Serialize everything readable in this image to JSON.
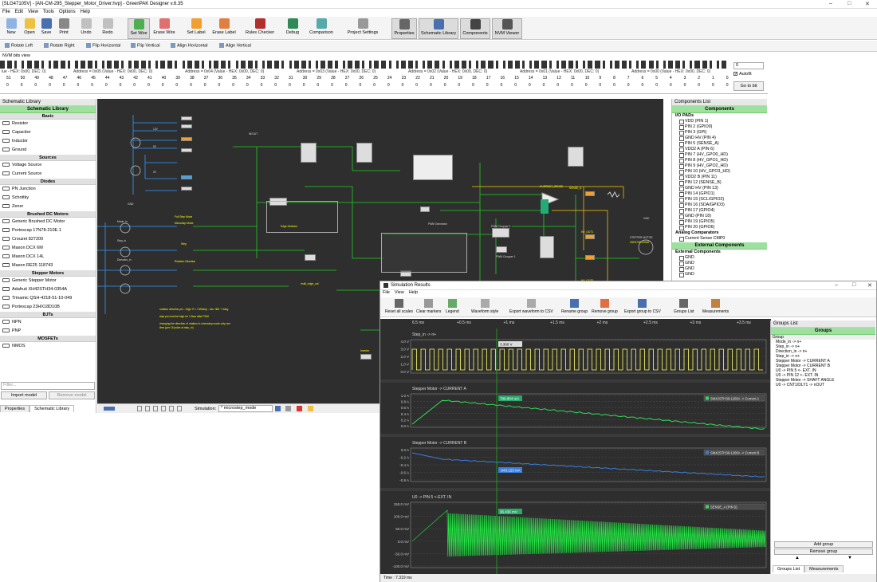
{
  "window": {
    "title": "[SLG47105V] - [AN-CM-295_Stepper_Motor_Driver.hvp] - GreenPAK Designer v.6.35",
    "min": "–",
    "max": "□",
    "close": "✕"
  },
  "menu": [
    "File",
    "Edit",
    "View",
    "Tools",
    "Options",
    "Help"
  ],
  "toolbar": [
    {
      "label": "New",
      "color": "#8fb4e3"
    },
    {
      "label": "Open",
      "color": "#f0c040"
    },
    {
      "label": "Save",
      "color": "#4a6fb0"
    },
    {
      "label": "Print",
      "color": "#888888"
    },
    {
      "label": "Undo",
      "color": "#c0c0c0"
    },
    {
      "label": "Redo",
      "color": "#c0c0c0"
    },
    {
      "label": "Set Wire",
      "color": "#4caf50",
      "on": true
    },
    {
      "label": "Erase Wire",
      "color": "#e07070"
    },
    {
      "label": "Set Label",
      "color": "#f0a030"
    },
    {
      "label": "Erase Label",
      "color": "#e08040"
    },
    {
      "label": "Rules Checker",
      "color": "#b03030"
    },
    {
      "label": "Debug",
      "color": "#2e8b57"
    },
    {
      "label": "Comparison",
      "color": "#5aa"
    },
    {
      "label": "Project Settings",
      "color": "#999999"
    },
    {
      "label": "Properties",
      "color": "#666666",
      "on": true
    },
    {
      "label": "Schematic Library",
      "color": "#4a6fb0",
      "on": true
    },
    {
      "label": "Components",
      "color": "#444444",
      "on": true
    },
    {
      "label": "NVM Viewer",
      "color": "#555555",
      "on": true
    }
  ],
  "toolbar2": [
    "Rotate Left",
    "Rotate Right",
    "Flip Horizontal",
    "Flip Vertical",
    "Align Horizontal",
    "Align Vertical"
  ],
  "nvm": {
    "title": "NVM bits view",
    "addresses": [
      "Address = 0x05 (Value - HEX: 0x00, DEC: 0)",
      "Address = 0x04 (Value - HEX: 0x00, DEC: 0)",
      "Address = 0x03 (Value - HEX: 0x00, DEC: 0)",
      "Address = 0x02 (Value - HEX: 0x00, DEC: 0)",
      "Address = 0x01 (Value - HEX: 0x00, DEC: 0)",
      "Address = 0x00 (Value - HEX: 0x00, DEC: 0)"
    ],
    "first_addr": "lue - HEX: 0x00, DEC: 0)",
    "bits": [
      "51",
      "50",
      "49",
      "48",
      "47",
      "46",
      "45",
      "44",
      "43",
      "42",
      "41",
      "40",
      "39",
      "38",
      "37",
      "36",
      "35",
      "34",
      "33",
      "32",
      "31",
      "30",
      "29",
      "28",
      "27",
      "26",
      "25",
      "24",
      "23",
      "22",
      "21",
      "20",
      "19",
      "18",
      "17",
      "16",
      "15",
      "14",
      "13",
      "12",
      "11",
      "10",
      "9",
      "8",
      "7",
      "6",
      "5",
      "4",
      "3",
      "2",
      "1",
      "0"
    ],
    "spin_value": "0",
    "autofit": "Autofit",
    "goto": "Go to bit"
  },
  "library": {
    "title": "Schematic Library",
    "header": "Schematic Library",
    "sections": [
      {
        "name": "Basic",
        "items": [
          "Resistor",
          "Capacitor",
          "Inductor",
          "Ground"
        ]
      },
      {
        "name": "Sources",
        "items": [
          "Voltage Source",
          "Current Source"
        ]
      },
      {
        "name": "Diodes",
        "items": [
          "PN Junction",
          "Schottky",
          "Zener"
        ]
      },
      {
        "name": "Brushed DC Motors",
        "items": [
          "Generic Brushed DC Motor",
          "Portescap 17N78-210E.1",
          "Crouzet 827200",
          "Maxon DCX 6M",
          "Maxon DCX 14L",
          "Maxon RE25 118743"
        ]
      },
      {
        "name": "Stepper Motors",
        "items": [
          "Generic Stepper Motor",
          "Adafruit XH42STH34-0354A",
          "Trinamic QSH-4218-51-10-049",
          "Portescap 23HX18D10B"
        ]
      },
      {
        "name": "BJTs",
        "items": [
          "NPN",
          "PNP"
        ]
      },
      {
        "name": "MOSFETs",
        "items": [
          "NMOS"
        ]
      }
    ],
    "filter_placeholder": "Filter...",
    "import": "Import model",
    "remove": "Remove model",
    "tabs": [
      "Properties",
      "Schematic Library"
    ]
  },
  "canvas": {
    "labels": [
      "12V",
      "5V",
      "0V",
      "GND",
      "Mode_in",
      "Step_in",
      "Direction_in",
      "Step",
      "Full Step Mode",
      "Microstep Mode",
      "Rotation Direction",
      "CNT/DLY/FSM0",
      "Edge Detector",
      "multi_edge_out",
      "PWM Generator",
      "PWM Chopper 0",
      "PWM Chopper 1",
      "Inverter",
      "SENSE_A",
      "STEPPER MOTOR",
      "2SH3700-1206A",
      "HV_OUT1",
      "HV_OUT0",
      "CURRENT_SENSE",
      "GND",
      "IN/OUT"
    ],
    "note": "rotation direction pin - High: R = CW/step - low: 360 + 0deg\n\nstep pin must be high for 1.8ms after PDM\n\nchanging the direction of rotation in microstep mode only one time (per 16 pulse at step_in)",
    "sim_label": "Simulation:",
    "sim_value": "* microstep_mode",
    "zoom": "-"
  },
  "components": {
    "title": "Components List",
    "header": "Components",
    "io_title": "I/O PADs",
    "io": [
      "VDD (PIN 1)",
      "PIN 2 (GPIO0)",
      "PIN 3 (GPI)",
      "GND HV (PIN 4)",
      "PIN 5 (SENSE_A)",
      "VDD2 A (PIN 6)",
      "PIN 7 (HV_GPO0_HD)",
      "PIN 8 (HV_GPO1_HD)",
      "PIN 9 (HV_GPO2_HD)",
      "PIN 10 (HV_GPO3_HD)",
      "VDD2 B (PIN 11)",
      "PIN 12 (SENSE_B)",
      "GND HV (PIN 13)",
      "PIN 14 (GPIO1)",
      "PIN 15 (SCL/GPIO2)",
      "PIN 16 (SDA/GPIO3)",
      "PIN 17 (GPIO4)",
      "GND (PIN 18)",
      "PIN 19 (GPIO5)",
      "PIN 20 (GPIO6)"
    ],
    "analog_title": "Analog Comparators",
    "analog": [
      "Current Sense CMP0"
    ],
    "ext_header": "External Components",
    "ext_title": "External Components",
    "ext": [
      "GND",
      "GND",
      "GND",
      "GND"
    ]
  },
  "sim": {
    "title": "Simulation Results",
    "menu": [
      "File",
      "View",
      "Help"
    ],
    "toolbar": [
      "Reset all scales",
      "Clear markers",
      "Legend",
      "Waveform style",
      "Export waveform to CSV",
      "Rename group",
      "Remove group",
      "Export group to CSV",
      "Groups List",
      "Measurements"
    ],
    "time_ticks": [
      "6.5 ms",
      "+0.5 ms",
      "+1 ms",
      "+1.5 ms",
      "+2 ms",
      "+2.5 ms",
      "+3 ms",
      "+3.5 ms"
    ],
    "plots": [
      {
        "title": "Step_in -> n+",
        "ticks": [
          "4.0 V",
          "3.0 V",
          "2.0 V",
          "1.0 V",
          "0.0 V"
        ],
        "marker": "3.300 V",
        "legend": ""
      },
      {
        "title": "Stepper Motor -> CURRENT A",
        "ticks": [
          "1.0 A",
          "0.8 A",
          "0.6 A",
          "0.4 A",
          "0.2 A",
          "0.0 A"
        ],
        "marker": "789.804 mA",
        "legend": "SM42STH38-1206A -> Current A"
      },
      {
        "title": "Stepper Motor -> CURRENT B",
        "ticks": [
          "0.0 A",
          "-0.2 A",
          "-0.4 A",
          "-0.6 A",
          "-0.8 A"
        ],
        "marker": "-343.123 mA",
        "legend": "SM42STH38-1206A -> Current B"
      },
      {
        "title": "U0 -> PIN 5 <-EXT. IN",
        "ticks": [
          "150.0 mV",
          "100.0 mV",
          "50.0 mV",
          "0.0 mV",
          "-50.0 mV",
          "-100.0 mV"
        ],
        "marker": "36.436 mV",
        "legend": "SENSE_A (PIN 5)"
      }
    ],
    "status": "Time : 7.319 ms",
    "groups_title": "Groups List",
    "groups_header": "Groups",
    "group_col": "Group",
    "groups": [
      "Mode_in -> n+",
      "Step_in -> n+",
      "Direction_in -> n+",
      "Step_in -> n+",
      "Stepper Motor -> CURRENT A",
      "Stepper Motor -> CURRENT B",
      "U0 -> PIN 5 <- EXT. IN",
      "U0 -> PIN 12 <- EXT. IN",
      "Stepper Motor -> SHAFT ANGLE",
      "U0 -> CNT1/DLY1 -> nOUT"
    ],
    "add_group": "Add group",
    "remove_group": "Remove group",
    "tabs": [
      "Groups List",
      "Measurements"
    ],
    "colors": {
      "step": "#ffff66",
      "currentA": "#33dd55",
      "currentB": "#3a7ee0",
      "sense": "#22ee44",
      "cursor": "#22aa22"
    }
  }
}
